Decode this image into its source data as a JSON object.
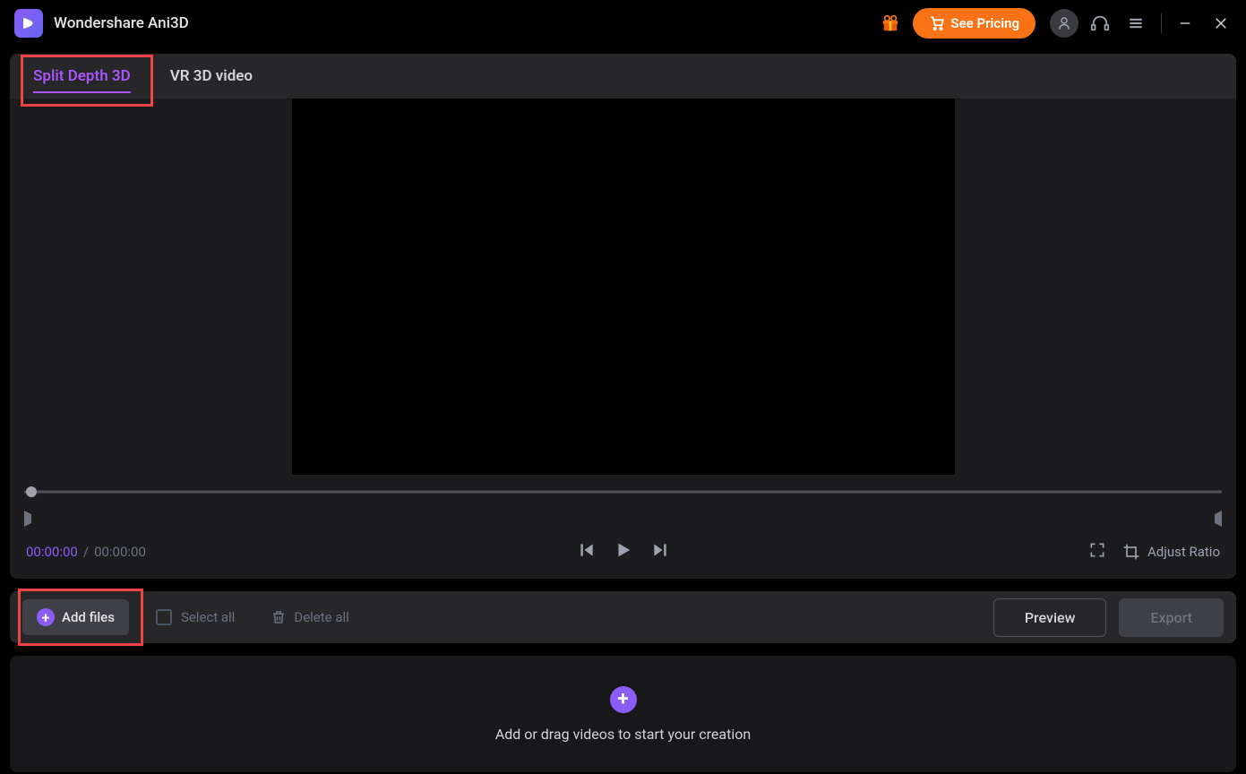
{
  "app": {
    "title": "Wondershare Ani3D"
  },
  "header": {
    "pricing_label": "See Pricing"
  },
  "tabs": {
    "split_depth": "Split Depth 3D",
    "vr_3d": "VR 3D video"
  },
  "player": {
    "time_current": "00:00:00",
    "time_separator": "/",
    "time_total": "00:00:00",
    "adjust_ratio": "Adjust Ratio"
  },
  "toolbar": {
    "add_files": "Add files",
    "select_all": "Select all",
    "delete_all": "Delete all",
    "preview": "Preview",
    "export": "Export"
  },
  "dropzone": {
    "hint": "Add or drag videos to start your creation"
  },
  "colors": {
    "accent": "#8b5cf6",
    "highlight": "#ef4444",
    "orange": "#f97316"
  }
}
